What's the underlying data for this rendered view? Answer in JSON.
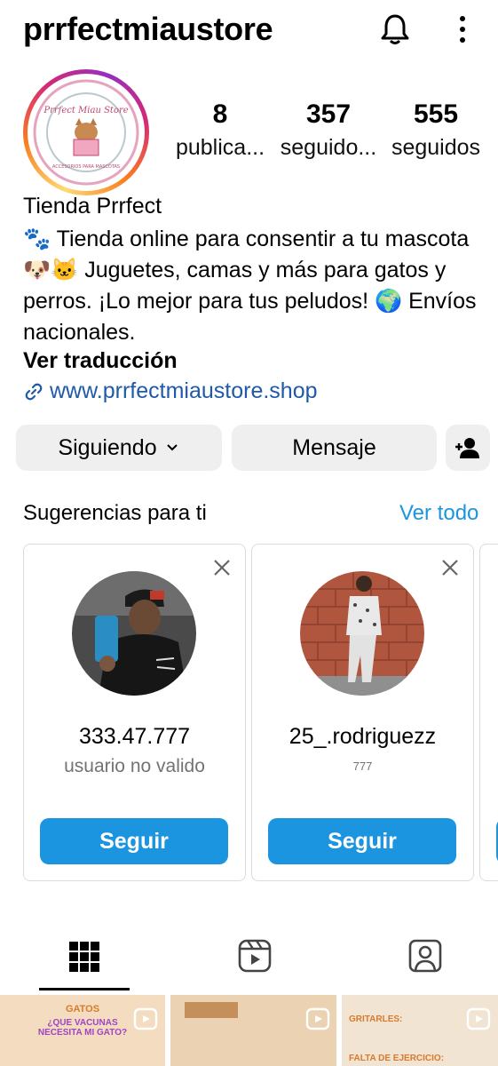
{
  "header": {
    "username": "prrfectmiaustore"
  },
  "avatar": {
    "logo_line1": "Prrfect Miau Store",
    "logo_ring_text": "ACCESORIOS PARA MASCOTAS"
  },
  "stats": [
    {
      "value": "8",
      "label": "publica..."
    },
    {
      "value": "357",
      "label": "seguido..."
    },
    {
      "value": "555",
      "label": "seguidos"
    }
  ],
  "bio": {
    "name": "Tienda Prrfect",
    "text": "🐾 Tienda online para consentir a tu mascota 🐶🐱 Juguetes, camas y más para gatos y perros. ¡Lo mejor para tus peludos! 🌍 Envíos nacionales.",
    "translate": "Ver traducción",
    "link": "www.prrfectmiaustore.shop"
  },
  "actions": {
    "following": "Siguiendo",
    "message": "Mensaje"
  },
  "suggestions": {
    "title": "Sugerencias para ti",
    "see_all": "Ver todo",
    "cards": [
      {
        "name": "333.47.777",
        "subtitle": "usuario no valido",
        "follow": "Seguir"
      },
      {
        "name": "25_.rodriguezz",
        "subtitle": "777",
        "follow": "Seguir"
      }
    ]
  },
  "grid": {
    "post1_title": "GATOS",
    "post1_heading": "¿QUE VACUNAS NECESITA MI GATO?",
    "post3_label1": "GRITARLES:",
    "post3_label2": "FALTA DE EJERCICIO:"
  },
  "colors": {
    "accent_blue": "#1b95e0",
    "link_blue": "#1e5aa8",
    "button_gray": "#efefef"
  }
}
